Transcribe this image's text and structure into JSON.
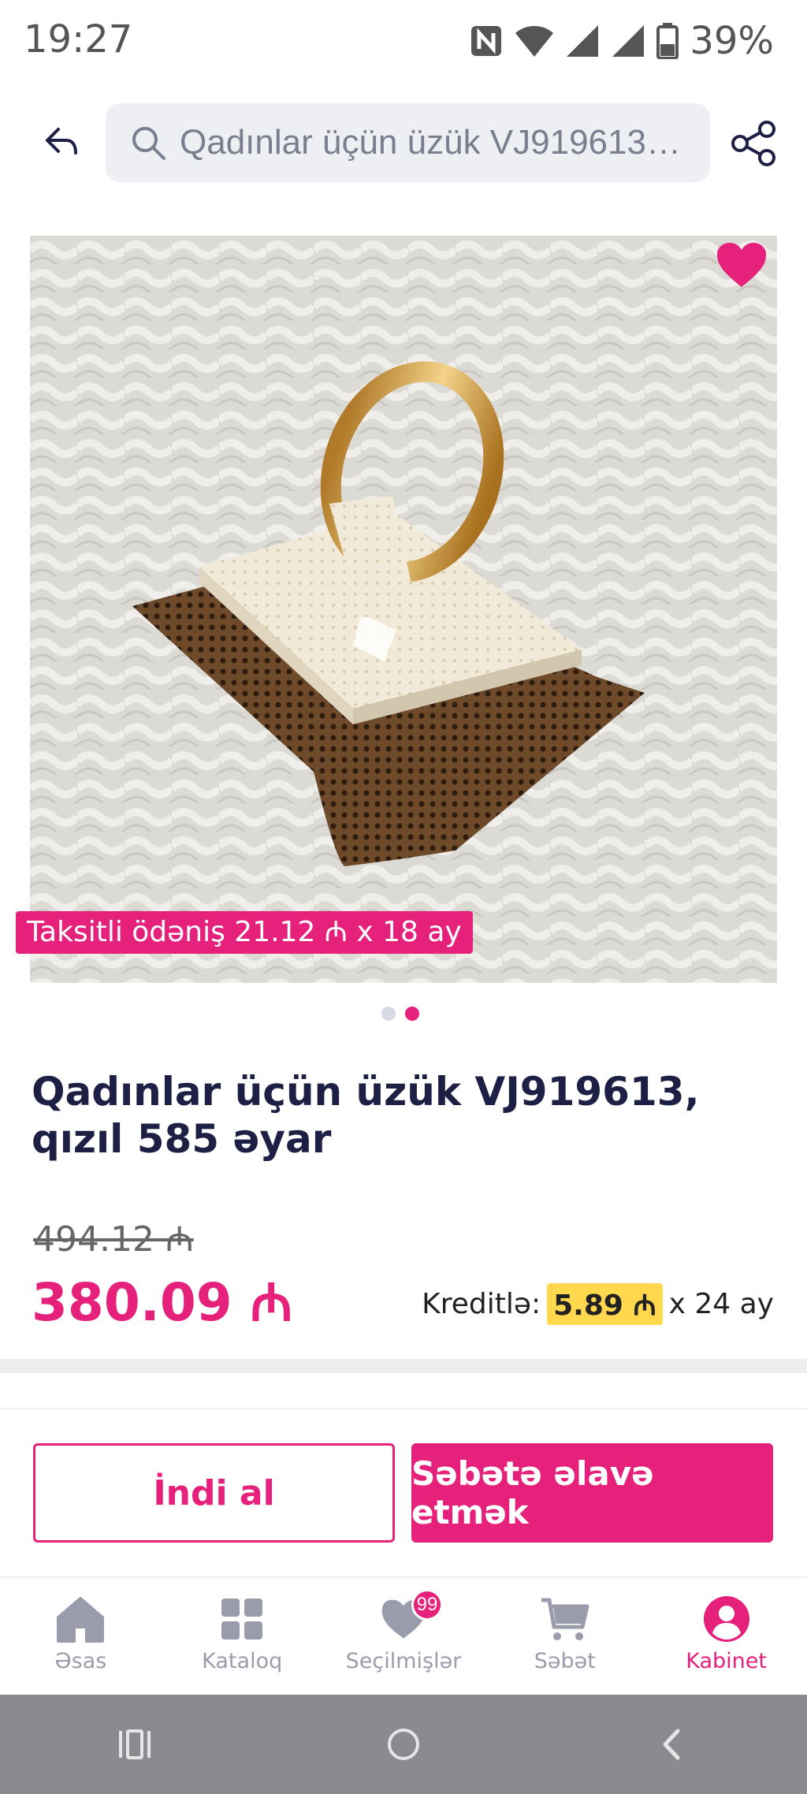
{
  "status_bar": {
    "time": "19:27",
    "battery": "39%",
    "icons": [
      "nfc-icon",
      "wifi-icon",
      "signal-icon",
      "signal-icon",
      "battery-icon"
    ]
  },
  "header": {
    "back_icon": "back-arrow-icon",
    "search_text": "Qadınlar üçün üzük VJ919613,...",
    "share_icon": "share-icon"
  },
  "gallery": {
    "installment_label": "Taksitli ödəniş 21.12 ₼ x 18 ay",
    "image_count": 2,
    "active_index": 1,
    "favorite_color": "#e5217c"
  },
  "product": {
    "title": "Qadınlar üçün üzük VJ919613, qızıl 585 əyar",
    "old_price": "494.12 ₼",
    "price": "380.09 ₼",
    "credit_label": "Kreditlə:",
    "credit_amount": "5.89 ₼",
    "credit_term": "x 24 ay"
  },
  "actions": {
    "buy_now": "İndi al",
    "add_to_cart": "Səbətə əlavə etmək"
  },
  "bottom_nav": {
    "items": [
      {
        "label": "Əsas",
        "icon": "home-icon"
      },
      {
        "label": "Kataloq",
        "icon": "grid-icon"
      },
      {
        "label": "Seçilmişlər",
        "icon": "heart-icon",
        "badge": "99"
      },
      {
        "label": "Səbət",
        "icon": "cart-icon"
      },
      {
        "label": "Kabinet",
        "icon": "user-icon",
        "active": true
      }
    ]
  },
  "colors": {
    "accent": "#e5217c",
    "text_dark": "#1d1f45",
    "credit_highlight": "#ffd84d"
  }
}
